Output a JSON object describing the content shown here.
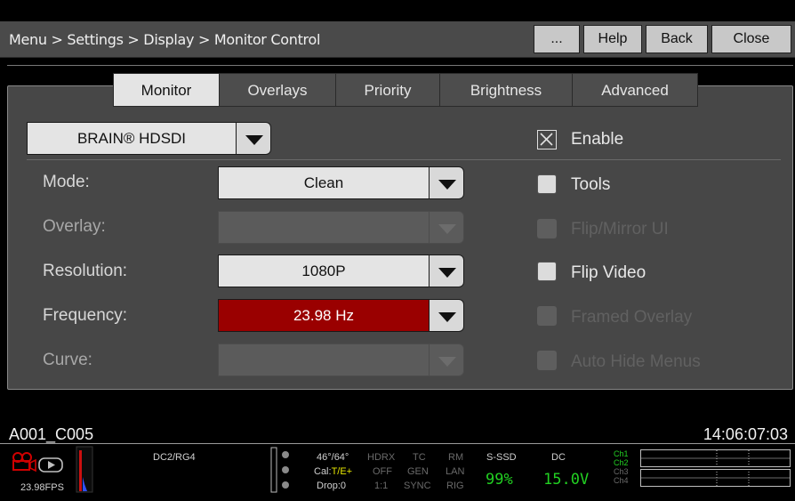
{
  "header": {
    "breadcrumb": "Menu > Settings > Display > Monitor Control",
    "more_label": "...",
    "help_label": "Help",
    "back_label": "Back",
    "close_label": "Close"
  },
  "tabs": [
    "Monitor",
    "Overlays",
    "Priority",
    "Brightness",
    "Advanced"
  ],
  "active_tab": "Monitor",
  "output": {
    "selected": "BRAIN® HDSDI"
  },
  "fields": {
    "mode": {
      "label": "Mode:",
      "value": "Clean"
    },
    "overlay": {
      "label": "Overlay:",
      "value": ""
    },
    "resolution": {
      "label": "Resolution:",
      "value": "1080P"
    },
    "frequency": {
      "label": "Frequency:",
      "value": "23.98 Hz"
    },
    "curve": {
      "label": "Curve:",
      "value": ""
    }
  },
  "options": {
    "enable": {
      "label": "Enable",
      "checked": true
    },
    "tools": {
      "label": "Tools",
      "checked": false
    },
    "flip_mirror_ui": {
      "label": "Flip/Mirror UI",
      "checked": false
    },
    "flip_video": {
      "label": "Flip Video",
      "checked": false
    },
    "framed_overlay": {
      "label": "Framed Overlay",
      "checked": false
    },
    "auto_hide_menus": {
      "label": "Auto Hide Menus",
      "checked": false
    }
  },
  "status": {
    "clip_name": "A001_C005",
    "timecode": "14:06:07:03",
    "fps": "23.98FPS",
    "color": "DC2/RG4",
    "iso": "46°/64°",
    "cal_prefix": "Cal:",
    "cal_value": "T/E+",
    "drop": "Drop:0",
    "hdrx": "HDRX",
    "hdrx_val": "OFF",
    "hdrx_ratio": "1:1",
    "tc": "TC",
    "tc_val": "GEN",
    "tc_sync": "SYNC",
    "rm": "RM",
    "rm_val": "LAN",
    "rm_rig": "RIG",
    "media_label": "S-SSD",
    "media_value": "99%",
    "power_label": "DC",
    "power_value": "15.0V",
    "channels": [
      "Ch1",
      "Ch2",
      "Ch3",
      "Ch4"
    ]
  },
  "colors": {
    "accent_red": "#9a0000",
    "green_status": "#22d022",
    "tab_active": "#e4e4e4"
  }
}
